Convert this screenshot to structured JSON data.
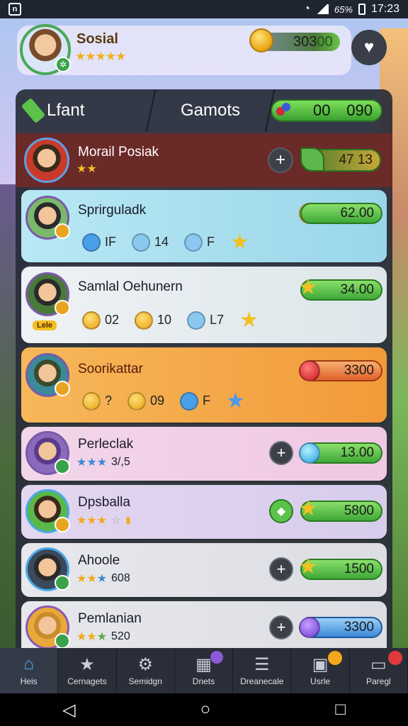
{
  "status_bar": {
    "left_icon": "n",
    "battery_text": "65%",
    "time": "17:23"
  },
  "profile": {
    "name": "Sosial",
    "stars": "★★★★★",
    "coins": "303",
    "coins_tail": "00"
  },
  "tabs": {
    "left": "Lfant",
    "center": "Gamots",
    "right_value_1": "00",
    "right_value_2": "090"
  },
  "leader": {
    "name": "Morail Posiak",
    "stars": "★★",
    "score": "47 13"
  },
  "players": [
    {
      "name": "Sprirguladk",
      "stats": [
        "IF",
        "14",
        "F"
      ],
      "score": "62.00"
    },
    {
      "name": "Samlal Oehunern",
      "badge": "Lele",
      "stats": [
        "02",
        "10",
        "L7"
      ],
      "score": "34.00"
    },
    {
      "name": "Soorikattar",
      "stats": [
        "?",
        "09",
        "F"
      ],
      "score": "3300"
    },
    {
      "name": "Perleclak",
      "rating": "3/,5",
      "score": "13.00"
    },
    {
      "name": "Dpsballa",
      "score": "5800"
    },
    {
      "name": "Ahoole",
      "rating": "608",
      "score": "1500"
    },
    {
      "name": "Pemlanian",
      "rating": "520",
      "score": "3300"
    }
  ],
  "bottom_nav": [
    {
      "label": "Heis",
      "icon": "home-icon"
    },
    {
      "label": "Cernagets",
      "icon": "star-icon"
    },
    {
      "label": "Semidgn",
      "icon": "gear-icon"
    },
    {
      "label": "Dnets",
      "icon": "grid-icon"
    },
    {
      "label": "Dreanecale",
      "icon": "list-icon"
    },
    {
      "label": "Usrle",
      "icon": "camera-icon"
    },
    {
      "label": "Paregl",
      "icon": "folder-icon"
    }
  ],
  "colors": {
    "panel": "#282c38",
    "leader_row": "#6a2a28",
    "accent_green": "#3fa838"
  }
}
